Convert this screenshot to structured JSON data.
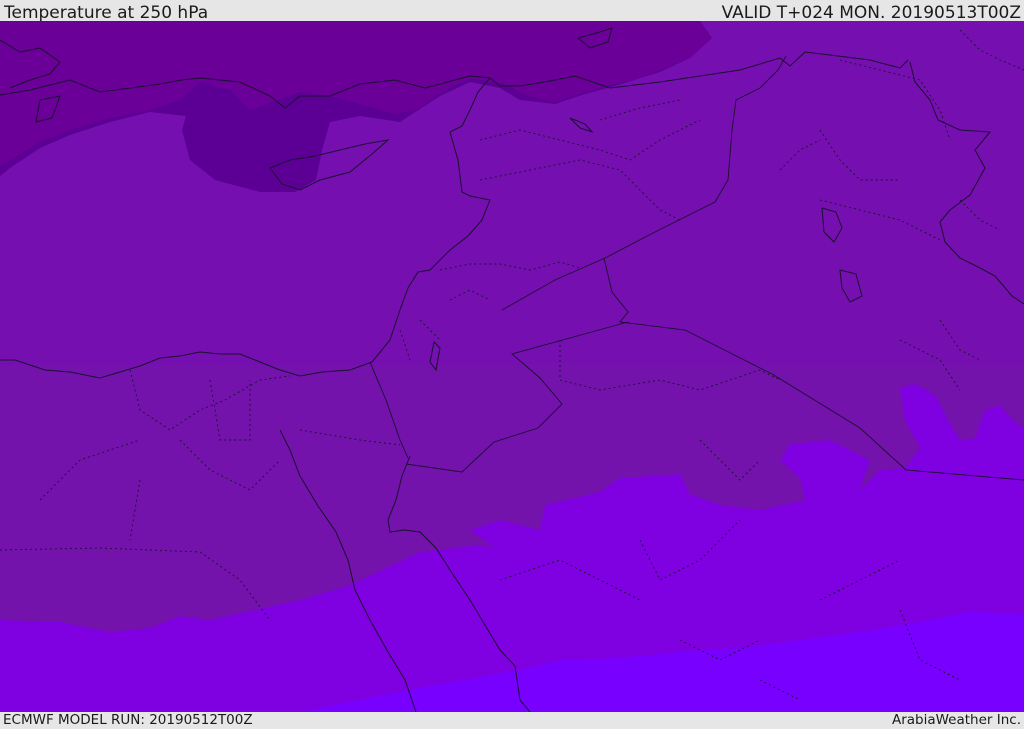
{
  "header": {
    "title": "Temperature at 250 hPa",
    "valid": "VALID T+024 MON. 20190513T00Z"
  },
  "footer": {
    "model_run": "ECMWF MODEL RUN: 20190512T00Z",
    "credit": "ArabiaWeather Inc."
  },
  "map": {
    "field": "temperature",
    "level": "250 hPa",
    "colors": {
      "coldest": "#5c0095",
      "cold": "#6a0098",
      "mid": "#760fb0",
      "mid_lower": "#7412ac",
      "warm": "#7f00e0",
      "warmest": "#7800ff",
      "lines": "#1a1030"
    }
  }
}
